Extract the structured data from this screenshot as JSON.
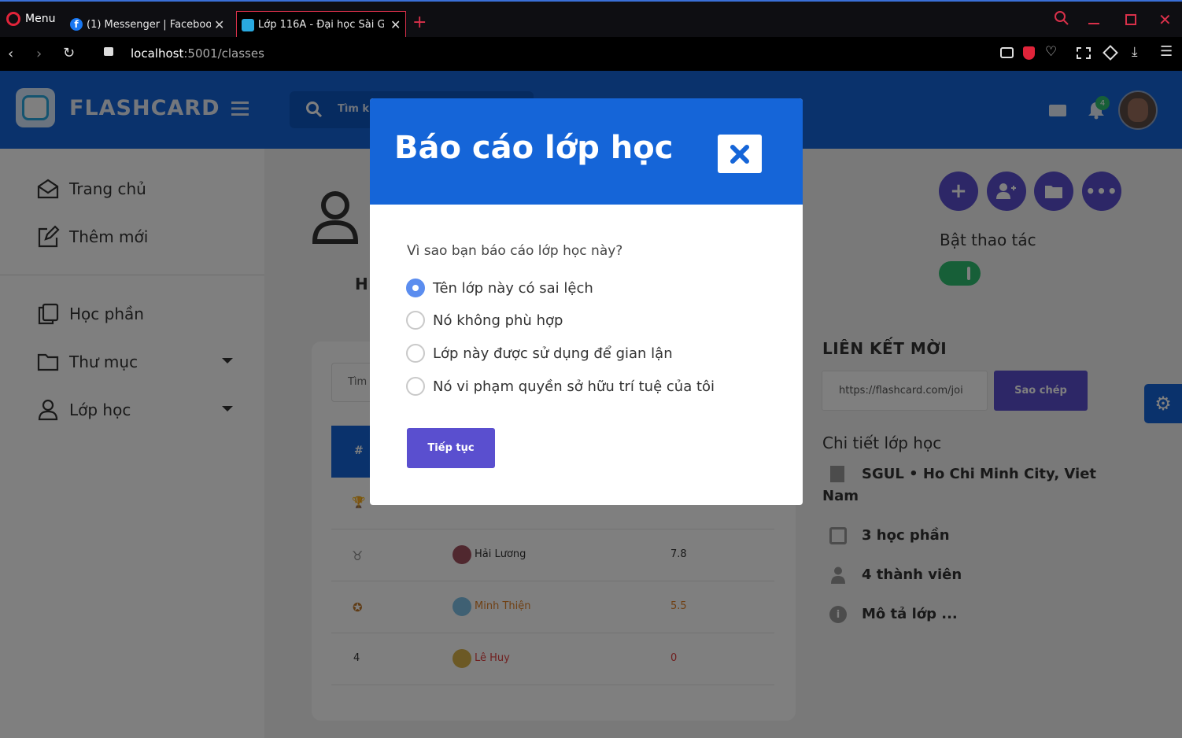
{
  "browser": {
    "menu_label": "Menu",
    "tabs": [
      {
        "title": "(1) Messenger | Facebook"
      },
      {
        "title": "Lớp 116A - Đại học Sài Gòn"
      }
    ],
    "address": {
      "host": "localhost",
      "port_path": ":5001/classes"
    }
  },
  "app": {
    "brand": "FLASHCARD",
    "search_placeholder": "Tìm kiếm",
    "notification_count": "4"
  },
  "sidebar": {
    "items": [
      {
        "label": "Trang chủ",
        "icon": "home-icon"
      },
      {
        "label": "Thêm mới",
        "icon": "edit-icon"
      },
      {
        "label": "Học phần",
        "icon": "copy-icon"
      },
      {
        "label": "Thư mục",
        "icon": "folder-icon"
      },
      {
        "label": "Lớp học",
        "icon": "user-icon"
      }
    ]
  },
  "class_panel": {
    "toggle_label": "Bật thao tác",
    "invite_title": "LIÊN KẾT MỜI",
    "invite_link": "https://flashcard.com/joi",
    "copy_button": "Sao chép",
    "details_title": "Chi tiết lớp học",
    "details": {
      "location_line1": "SGUL • Ho Chi Minh City, Viet",
      "location_line2": "Nam",
      "modules": "3 học phần",
      "members": "4 thành viên",
      "description": "Mô tả lớp ..."
    }
  },
  "leaderboard": {
    "search_placeholder": "Tìm",
    "header_rank": "#",
    "heading_fragment": "H",
    "rows": [
      {
        "rank": "4",
        "name": "Lê Huy",
        "score": "0"
      },
      {
        "name": "Hải Lương",
        "score": "7.8"
      },
      {
        "name": "Minh Thiện",
        "score": "5.5"
      }
    ]
  },
  "modal": {
    "title": "Báo cáo lớp học",
    "question": "Vì sao bạn báo cáo lớp học này?",
    "options": [
      {
        "label": "Tên lớp này có sai lệch",
        "checked": true
      },
      {
        "label": "Nó không phù hợp",
        "checked": false
      },
      {
        "label": "Lớp này được sử dụng để gian lận",
        "checked": false
      },
      {
        "label": "Nó vi phạm quyền sở hữu trí tuệ của tôi",
        "checked": false
      }
    ],
    "continue_label": "Tiếp tục"
  },
  "colors": {
    "primary": "#1565d8",
    "accent": "#5a4fcf",
    "toggle": "#2fbf71"
  }
}
